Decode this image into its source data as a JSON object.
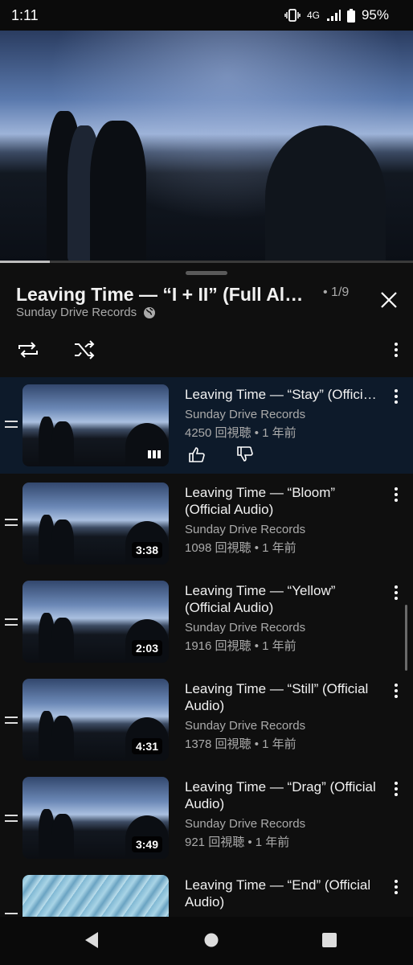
{
  "status_bar": {
    "time": "1:11",
    "network": "4G",
    "battery": "95%"
  },
  "video": {
    "progress_fraction": 0.12
  },
  "playlist": {
    "title": "Leaving Time — “I + II” (Full Album)",
    "position": "• 1/9",
    "channel": "Sunday Drive Records"
  },
  "items": [
    {
      "title": "Leaving Time — “Stay” (Official Audio)",
      "channel": "Sunday Drive Records",
      "meta": "4250 回視聴 • 1 年前",
      "duration": "",
      "playing": true
    },
    {
      "title": "Leaving Time — “Bloom” (Official Audio)",
      "channel": "Sunday Drive Records",
      "meta": "1098 回視聴 • 1 年前",
      "duration": "3:38"
    },
    {
      "title": "Leaving Time — “Yellow” (Official Audio)",
      "channel": "Sunday Drive Records",
      "meta": "1916 回視聴 • 1 年前",
      "duration": "2:03"
    },
    {
      "title": "Leaving Time — “Still” (Official Audio)",
      "channel": "Sunday Drive Records",
      "meta": "1378 回視聴 • 1 年前",
      "duration": "4:31"
    },
    {
      "title": "Leaving Time — “Drag” (Official Audio)",
      "channel": "Sunday Drive Records",
      "meta": "921 回視聴 • 1 年前",
      "duration": "3:49"
    },
    {
      "title": "Leaving Time — “End” (Official Audio)",
      "channel": "",
      "meta": "",
      "duration": ""
    }
  ],
  "colors": {
    "background": "#0f0f0f",
    "active_row": "#0d1a2a",
    "secondary_text": "#aaaaaa"
  },
  "icons": {
    "repeat": "repeat-icon",
    "shuffle": "shuffle-icon",
    "globe": "globe-icon",
    "close": "close-icon",
    "like": "thumbs-up-icon",
    "dislike": "thumbs-down-icon"
  }
}
